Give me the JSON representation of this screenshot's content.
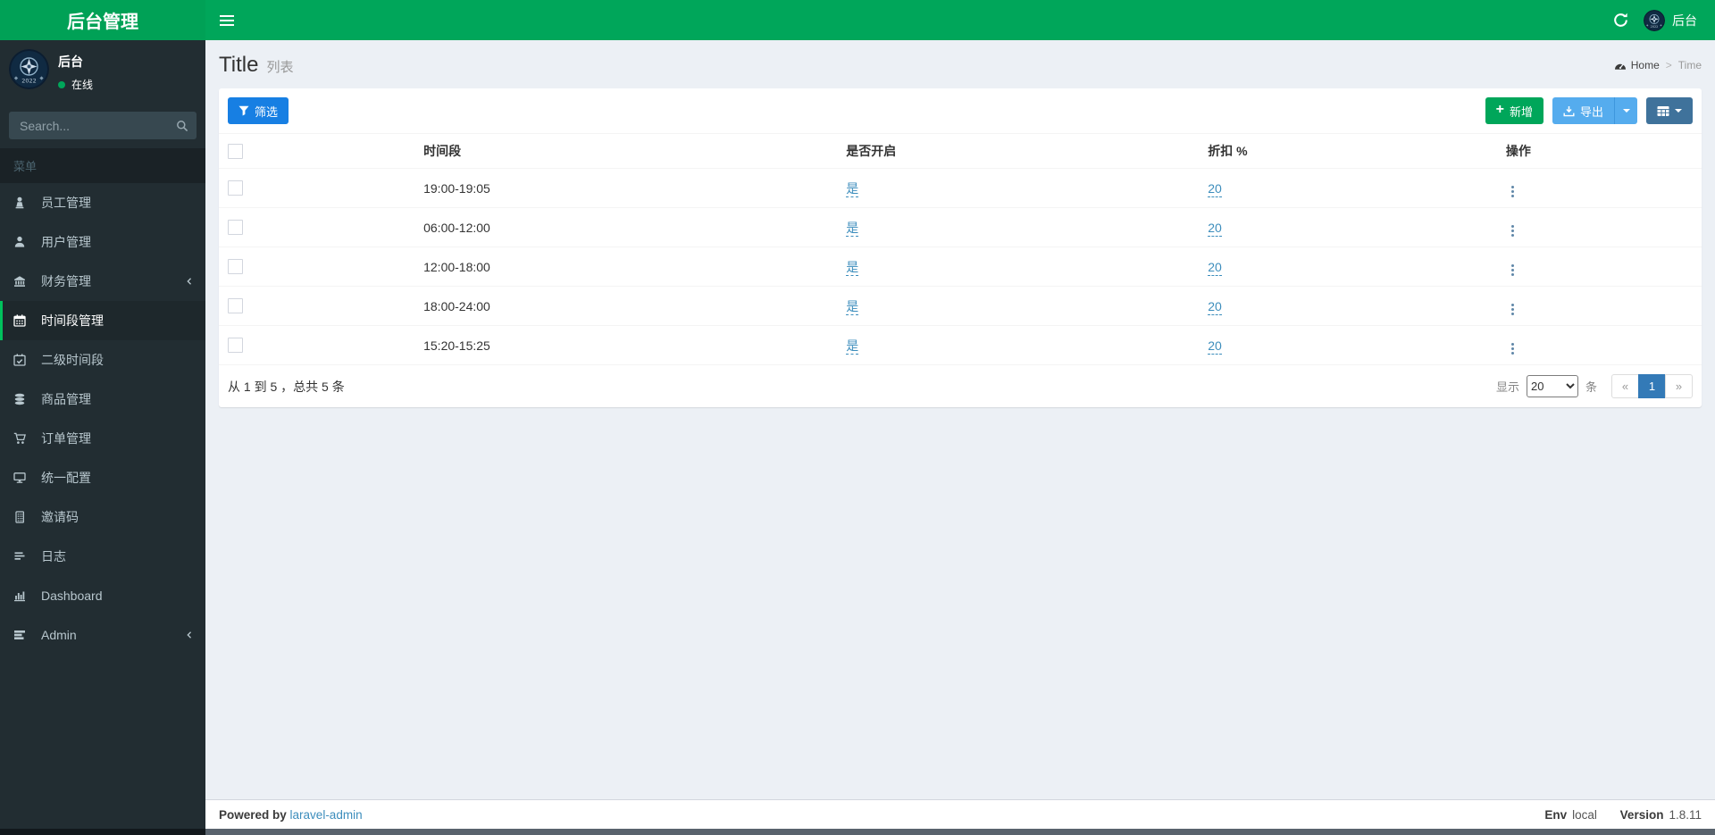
{
  "colors": {
    "navbar_green": "#00a65a",
    "sidebar_dark": "#222d32",
    "active_border_green": "#00c15c",
    "filter_blue": "#177fe3",
    "add_green": "#00a65a",
    "export_blue": "#55acee",
    "column_btn_blue": "#3f729b",
    "link_blue": "#3c8dbc",
    "pagination_active_blue": "#337ab7",
    "content_bg": "#ecf0f5"
  },
  "header": {
    "logo": "后台管理",
    "navbar_user": "后台"
  },
  "sidebar": {
    "user_name": "后台",
    "user_status": "在线",
    "search_placeholder": "Search...",
    "menu_header": "菜单",
    "items": [
      {
        "label": "员工管理",
        "icon": "staff-icon"
      },
      {
        "label": "用户管理",
        "icon": "user-icon"
      },
      {
        "label": "财务管理",
        "icon": "bank-icon"
      },
      {
        "label": "时间段管理",
        "icon": "calendar-icon"
      },
      {
        "label": "二级时间段",
        "icon": "calendar-check-icon"
      },
      {
        "label": "商品管理",
        "icon": "database-icon"
      },
      {
        "label": "订单管理",
        "icon": "cart-icon"
      },
      {
        "label": "统一配置",
        "icon": "desktop-icon"
      },
      {
        "label": "邀请码",
        "icon": "invite-code-icon"
      },
      {
        "label": "日志",
        "icon": "log-icon"
      },
      {
        "label": "Dashboard",
        "icon": "bar-chart-icon"
      },
      {
        "label": "Admin",
        "icon": "tasks-icon"
      }
    ]
  },
  "page": {
    "title": "Title",
    "subtitle": "列表",
    "breadcrumb_home": "Home",
    "breadcrumb_sep": ">",
    "breadcrumb_current": "Time"
  },
  "toolbar": {
    "filter": "筛选",
    "add": "新增",
    "export": "导出"
  },
  "table": {
    "headers": [
      "时间段",
      "是否开启",
      "折扣 %",
      "操作"
    ],
    "rows": [
      {
        "time": "19:00-19:05",
        "enabled": "是",
        "discount": "20"
      },
      {
        "time": "06:00-12:00",
        "enabled": "是",
        "discount": "20"
      },
      {
        "time": "12:00-18:00",
        "enabled": "是",
        "discount": "20"
      },
      {
        "time": "18:00-24:00",
        "enabled": "是",
        "discount": "20"
      },
      {
        "time": "15:20-15:25",
        "enabled": "是",
        "discount": "20"
      }
    ]
  },
  "pagination": {
    "summary": "从 1 到 5 ，总共 5 条",
    "show": "显示",
    "unit": "条",
    "per_page": "20",
    "prev": "«",
    "page": "1",
    "next": "»"
  },
  "footer": {
    "powered": "Powered by",
    "brand": "laravel-admin",
    "env_label": "Env",
    "env_value": "local",
    "version_label": "Version",
    "version_value": "1.8.11"
  }
}
